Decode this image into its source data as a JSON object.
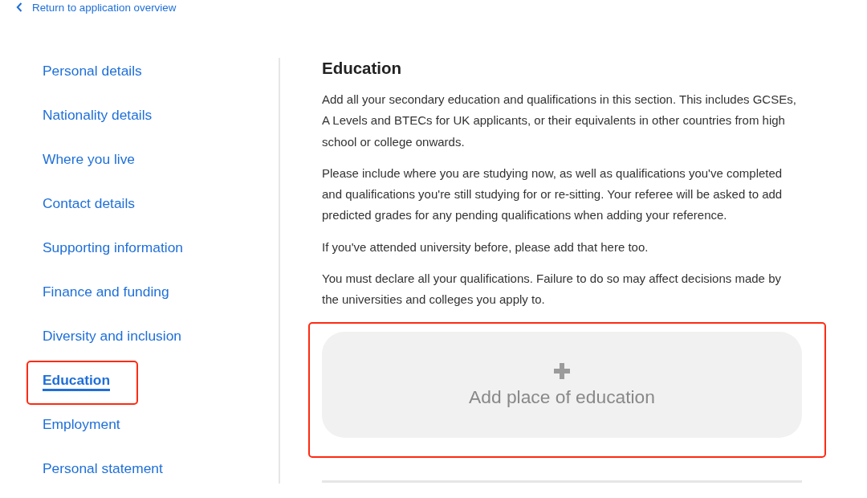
{
  "back_link": {
    "label": "Return to application overview"
  },
  "sidebar": {
    "items": [
      {
        "label": "Personal details",
        "selected": false,
        "highlighted": false
      },
      {
        "label": "Nationality details",
        "selected": false,
        "highlighted": false
      },
      {
        "label": "Where you live",
        "selected": false,
        "highlighted": false
      },
      {
        "label": "Contact details",
        "selected": false,
        "highlighted": false
      },
      {
        "label": "Supporting information",
        "selected": false,
        "highlighted": false
      },
      {
        "label": "Finance and funding",
        "selected": false,
        "highlighted": false
      },
      {
        "label": "Diversity and inclusion",
        "selected": false,
        "highlighted": false
      },
      {
        "label": "Education",
        "selected": true,
        "highlighted": true
      },
      {
        "label": "Employment",
        "selected": false,
        "highlighted": false
      },
      {
        "label": "Personal statement",
        "selected": false,
        "highlighted": false
      }
    ]
  },
  "section": {
    "title": "Education",
    "paragraphs": [
      "Add all your secondary education and qualifications in this section. This includes GCSEs, A Levels and BTECs for UK applicants, or their equivalents in other countries from high school or college onwards.",
      "Please include where you are studying now, as well as qualifications you've completed and qualifications you're still studying for or re-sitting. Your referee will be asked to add predicted grades for any pending qualifications when adding your reference.",
      "If you've attended university before, please add that here too.",
      "You must declare all your qualifications. Failure to do so may affect decisions made by the universities and colleges you apply to."
    ],
    "add_button": {
      "label": "Add place of education",
      "highlighted": true
    }
  }
}
